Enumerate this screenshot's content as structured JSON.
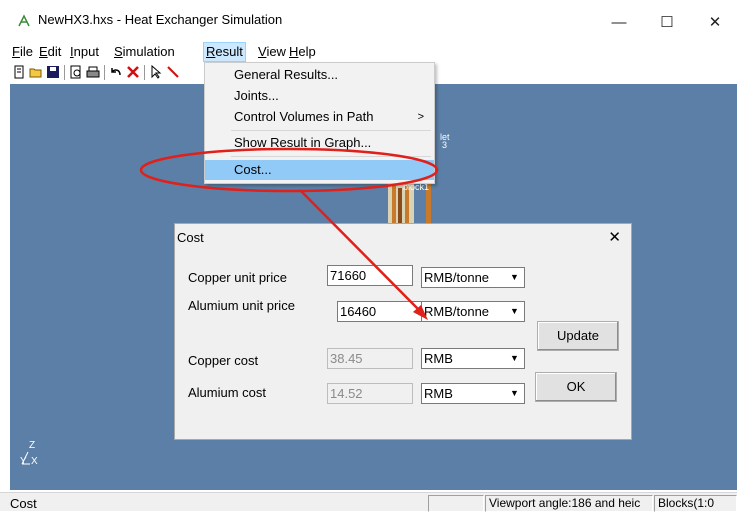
{
  "window": {
    "title": "NewHX3.hxs - Heat Exchanger Simulation",
    "minimize": "—",
    "maximize": "☐",
    "close": "✕"
  },
  "menubar": {
    "items": [
      {
        "prefix": "",
        "mnemonic": "F",
        "rest": "ile"
      },
      {
        "prefix": "",
        "mnemonic": "E",
        "rest": "dit"
      },
      {
        "prefix": "",
        "mnemonic": "I",
        "rest": "nput"
      },
      {
        "prefix": "",
        "mnemonic": "S",
        "rest": "imulation"
      },
      {
        "prefix": "",
        "mnemonic": "R",
        "rest": "esult"
      },
      {
        "prefix": "",
        "mnemonic": "V",
        "rest": "iew"
      },
      {
        "prefix": "",
        "mnemonic": "H",
        "rest": "elp"
      }
    ]
  },
  "result_menu": {
    "items": [
      "General Results...",
      "Joints...",
      "Control Volumes in Path",
      "Show Result in Graph...",
      "Cost..."
    ],
    "submenu_arrow": ">"
  },
  "viewport": {
    "labels": [
      "let",
      "3",
      "block1"
    ],
    "axis_label": "Z",
    "axis_x": "X",
    "axis_y": "Y"
  },
  "cost_dialog": {
    "title": "Cost",
    "close": "✕",
    "copper_price_label": "Copper unit price",
    "copper_price_value": "71660",
    "copper_price_unit": "RMB/tonne",
    "alumium_price_label": "Alumium unit price",
    "alumium_price_value": "16460",
    "alumium_price_unit": "RMB/tonne",
    "copper_cost_label": "Copper cost",
    "copper_cost_value": "38.45",
    "copper_cost_unit": "RMB",
    "alumium_cost_label": "Alumium cost",
    "alumium_cost_value": "14.52",
    "alumium_cost_unit": "RMB",
    "update_button": "Update",
    "ok_button": "OK"
  },
  "statusbar": {
    "left": "Cost",
    "viewport_info": "Viewport angle:186 and heic",
    "blocks": "Blocks(1:0"
  },
  "colors": {
    "viewport": "#5b7fa6",
    "annotation": "#e0201a",
    "menu_highlight": "#91c9f7"
  }
}
